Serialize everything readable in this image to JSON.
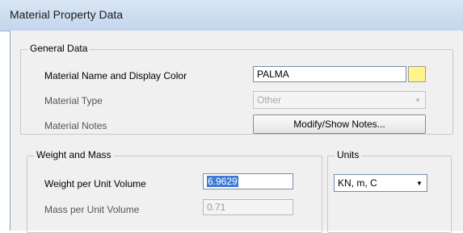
{
  "window": {
    "title": "Material Property Data"
  },
  "general": {
    "group_label": "General Data",
    "name_label": "Material Name and Display Color",
    "name_value": "PALMA",
    "display_color": "#fff48a",
    "type_label": "Material Type",
    "type_value": "Other",
    "notes_label": "Material Notes",
    "notes_button": "Modify/Show Notes..."
  },
  "weight_mass": {
    "group_label": "Weight and Mass",
    "weight_label": "Weight per Unit Volume",
    "weight_value": "6.9629",
    "mass_label": "Mass per Unit Volume",
    "mass_value": "0.71"
  },
  "units": {
    "group_label": "Units",
    "value": "KN, m, C"
  },
  "icons": {
    "dropdown": "chevron-down-icon"
  }
}
